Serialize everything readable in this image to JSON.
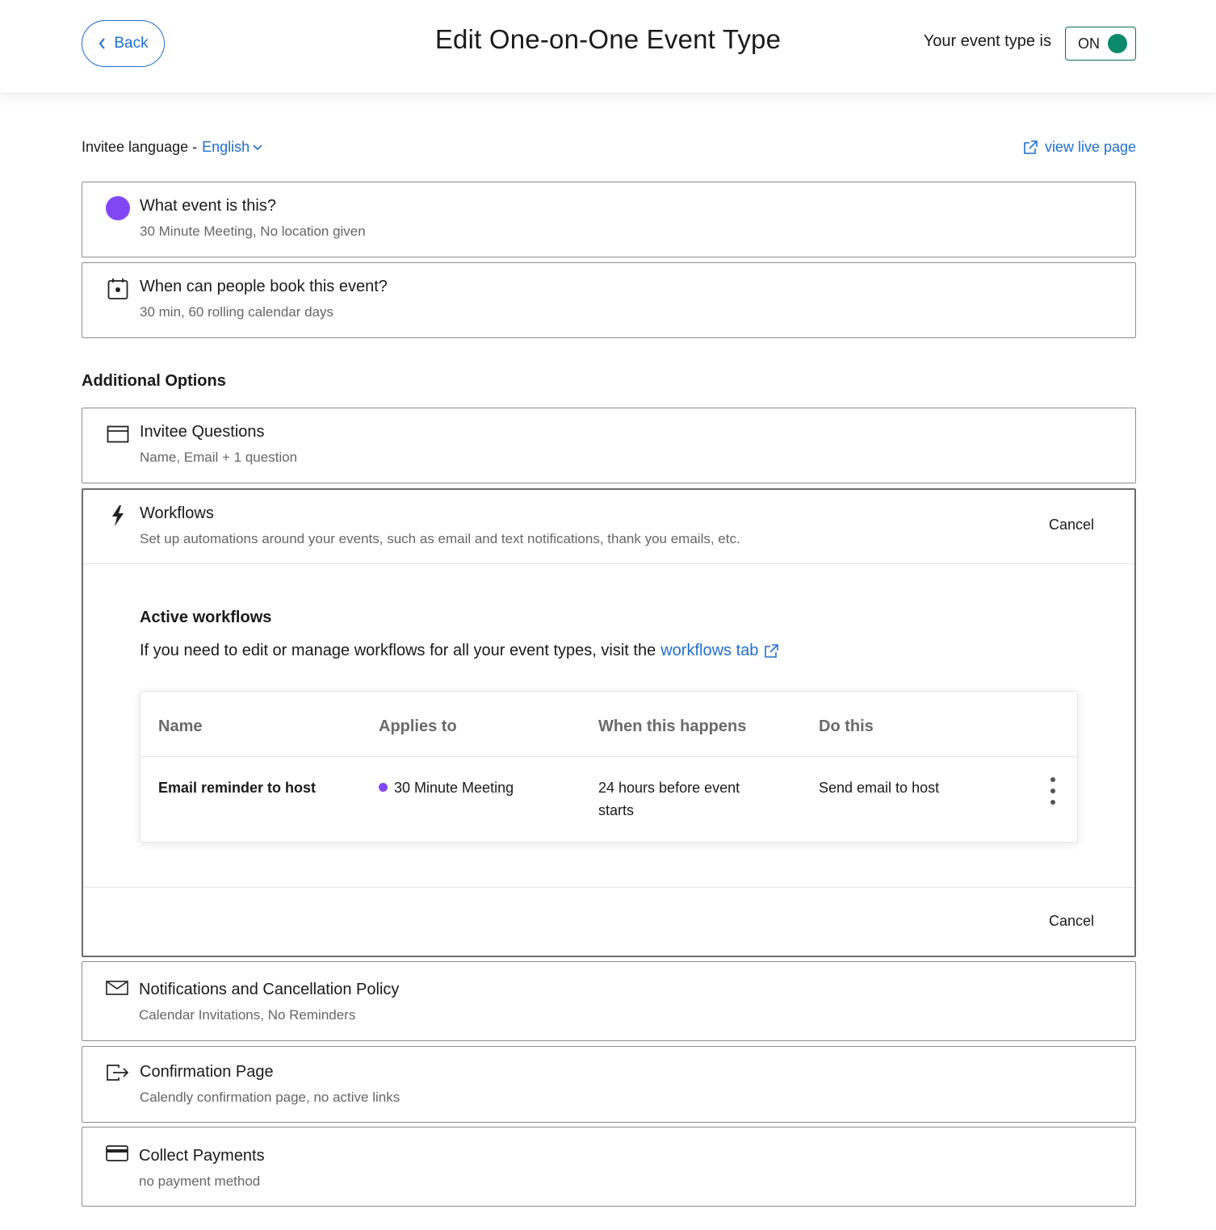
{
  "header": {
    "back_label": "Back",
    "title": "Edit One-on-One Event Type",
    "status_label": "Your event type is",
    "toggle_state": "ON"
  },
  "lang": {
    "label": "Invitee language -",
    "value": "English",
    "live_link": "view live page"
  },
  "cards": {
    "event": {
      "title": "What event is this?",
      "subtitle": "30 Minute Meeting, No location given",
      "color": "#8247f5"
    },
    "booking": {
      "title": "When can people book this event?",
      "subtitle": "30 min, 60 rolling calendar days"
    },
    "questions": {
      "title": "Invitee Questions",
      "subtitle": "Name, Email + 1 question"
    },
    "notifications": {
      "title": "Notifications and Cancellation Policy",
      "subtitle": "Calendar Invitations, No Reminders"
    },
    "confirmation": {
      "title": "Confirmation Page",
      "subtitle": "Calendly confirmation page, no active links"
    },
    "payments": {
      "title": "Collect Payments",
      "subtitle": "no payment method"
    }
  },
  "additional_heading": "Additional Options",
  "workflows": {
    "title": "Workflows",
    "subtitle": "Set up automations around your events, such as email and text notifications, thank you emails, etc.",
    "cancel_label": "Cancel",
    "active_title": "Active workflows",
    "active_text": "If you need to edit or manage workflows for all your event types, visit the",
    "active_link": "workflows tab",
    "table": {
      "headers": [
        "Name",
        "Applies to",
        "When this happens",
        "Do this"
      ],
      "rows": [
        {
          "name": "Email reminder to host",
          "applies_to": "30 Minute Meeting",
          "when": "24 hours before event starts",
          "action": "Send email to host"
        }
      ]
    },
    "footer_cancel_label": "Cancel"
  }
}
